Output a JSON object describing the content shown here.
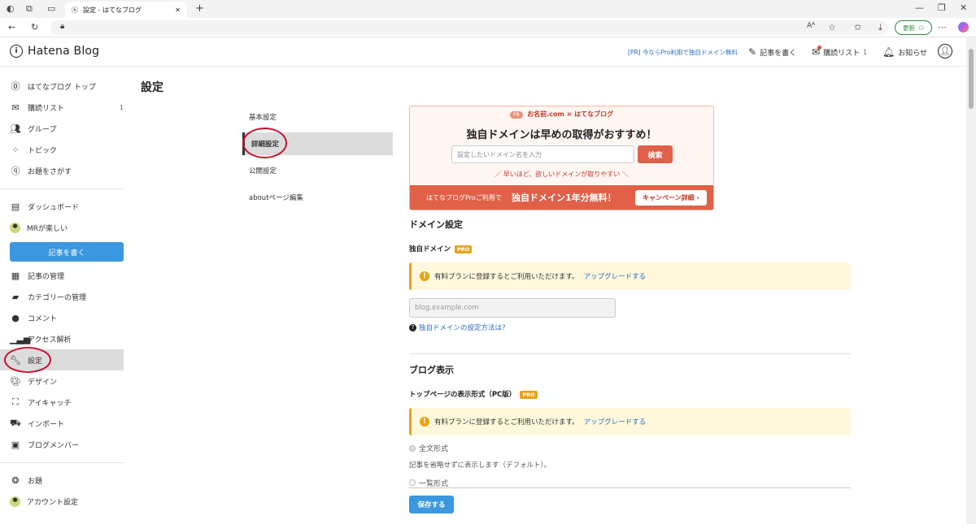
{
  "browser": {
    "tab_title": "設定 - はてなブログ",
    "update_label": "更新"
  },
  "header": {
    "logo_text": "Hatena Blog",
    "promo_link": "[PR] 今ならPro利用で独自ドメイン無料",
    "write_label": "記事を書く",
    "reading_list_label": "購読リスト",
    "reading_list_count": "1",
    "notifications_label": "お知らせ"
  },
  "sidebar": {
    "items_top": [
      {
        "label": "はてなブログ トップ",
        "icon": "hatena-icon"
      },
      {
        "label": "購読リスト",
        "icon": "reading-list-icon",
        "count": "1"
      },
      {
        "label": "グループ",
        "icon": "group-icon"
      },
      {
        "label": "トピック",
        "icon": "topic-icon"
      },
      {
        "label": "お題をさがす",
        "icon": "search-theme-icon"
      }
    ],
    "items_mid": [
      {
        "label": "ダッシュボード",
        "icon": "dashboard-icon"
      },
      {
        "label": "MRが楽しい",
        "icon": "blog-avatar-icon"
      }
    ],
    "write_button": "記事を書く",
    "items_manage": [
      {
        "label": "記事の管理",
        "icon": "article-icon"
      },
      {
        "label": "カテゴリーの管理",
        "icon": "folder-icon"
      },
      {
        "label": "コメント",
        "icon": "comment-icon"
      },
      {
        "label": "アクセス解析",
        "icon": "analytics-icon"
      },
      {
        "label": "設定",
        "icon": "wrench-icon"
      },
      {
        "label": "デザイン",
        "icon": "palette-icon"
      },
      {
        "label": "アイキャッチ",
        "icon": "eyecatch-icon"
      },
      {
        "label": "インポート",
        "icon": "truck-icon"
      },
      {
        "label": "ブログメンバー",
        "icon": "member-icon"
      }
    ],
    "items_bottom": [
      {
        "label": "お題",
        "icon": "theme-icon"
      },
      {
        "label": "アカウント設定",
        "icon": "account-avatar-icon"
      }
    ]
  },
  "page": {
    "title": "設定",
    "submenu": [
      "基本設定",
      "詳細設定",
      "公開設定",
      "aboutページ編集"
    ],
    "ad": {
      "pr_badge": "PR",
      "brand": "お名前.com × はてなブログ",
      "headline": "独自ドメインは早めの取得がおすすめ！",
      "input_placeholder": "設定したいドメイン名を入力",
      "search_button": "検索",
      "tagline": "／ 早いほど、欲しいドメインが取りやすい ＼",
      "banner_text_small": "はてなブログProご利用で",
      "banner_text_big": "独自ドメイン1年分無料！",
      "campaign_button": "キャンペーン詳細"
    },
    "domain": {
      "heading": "ドメイン設定",
      "label": "独自ドメイン",
      "pro": "PRO",
      "notice": "有料プランに登録するとご利用いただけます。",
      "upgrade": "アップグレードする",
      "input_placeholder": "blog.example.com",
      "help_link": "独自ドメインの設定方法は？"
    },
    "display": {
      "heading": "ブログ表示",
      "label": "トップページの表示形式（PC版）",
      "pro": "PRO",
      "notice": "有料プランに登録するとご利用いただけます。",
      "upgrade": "アップグレードする",
      "option1": "全文形式",
      "option1_desc": "記事を省略せずに表示します（デフォルト）。",
      "option2": "一覧形式"
    },
    "save_button": "保存する"
  },
  "colors": {
    "accent_blue": "#3a97e0",
    "ad_red": "#e06048",
    "pro_orange": "#e8a317",
    "annotation_red": "#c8102e"
  }
}
